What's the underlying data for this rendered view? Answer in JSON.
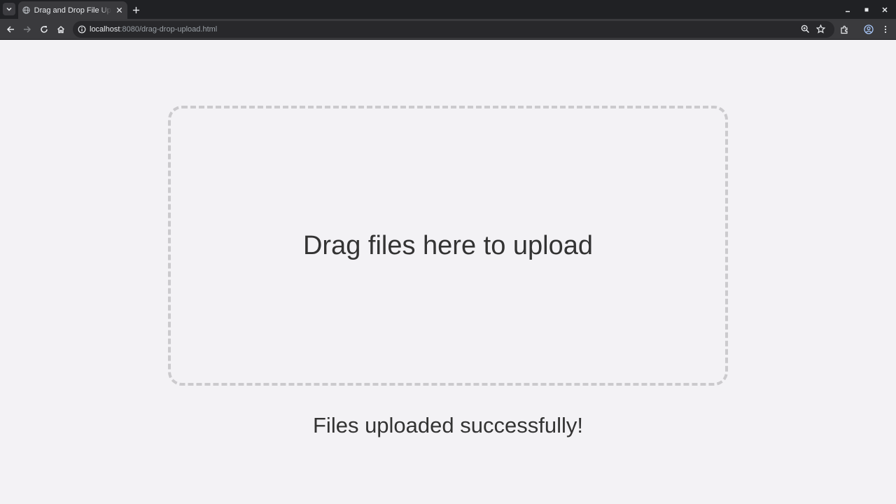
{
  "browser": {
    "tab": {
      "title": "Drag and Drop File Upload"
    },
    "address_bar": {
      "host": "localhost",
      "path": ":8080/drag-drop-upload.html"
    },
    "icons": [
      "tab-search-icon",
      "globe-icon",
      "close-icon",
      "plus-icon",
      "minimize-icon",
      "maximize-icon",
      "back-arrow-icon",
      "forward-arrow-icon",
      "reload-icon",
      "home-icon",
      "info-icon",
      "zoom-icon",
      "star-icon",
      "extensions-icon",
      "profile-icon",
      "menu-icon"
    ],
    "colors": {
      "tabbar": "#202124",
      "toolbar": "#3a3a3d",
      "omnibox": "#28282b"
    }
  },
  "page": {
    "dropzone_text": "Drag files here to upload",
    "status_message": "Files uploaded successfully!",
    "colors": {
      "background": "#f3f2f5",
      "dropzone_border": "#cbcacd",
      "text": "#333333"
    }
  }
}
